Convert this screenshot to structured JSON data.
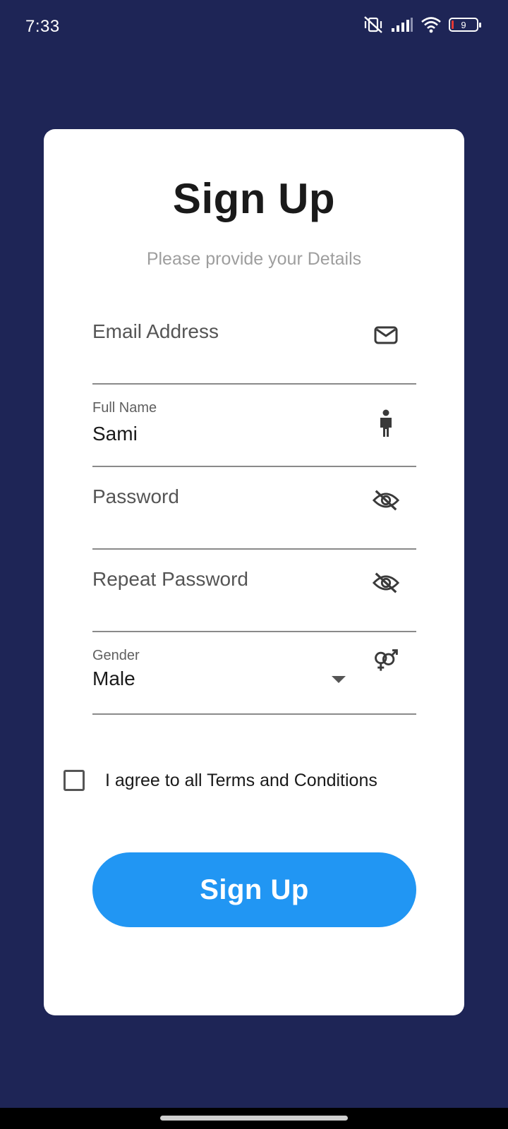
{
  "status_bar": {
    "time": "7:33",
    "battery_level": "9",
    "icons": [
      "vibrate-off-icon",
      "signal-icon",
      "wifi-icon",
      "battery-icon"
    ]
  },
  "colors": {
    "background": "#1e2556",
    "card": "#ffffff",
    "accent": "#2196f3"
  },
  "form": {
    "title": "Sign Up",
    "subtitle": "Please provide your Details",
    "email": {
      "placeholder": "Email Address",
      "value": "",
      "icon": "mail-icon"
    },
    "full_name": {
      "label": "Full Name",
      "value": "Sami",
      "icon": "person-icon"
    },
    "password": {
      "placeholder": "Password",
      "value": "",
      "icon": "visibility-off-icon"
    },
    "repeat_password": {
      "placeholder": "Repeat Password",
      "value": "",
      "icon": "visibility-off-icon"
    },
    "gender": {
      "label": "Gender",
      "selected": "Male",
      "icon": "gender-icon"
    },
    "terms": {
      "label": "I agree to all Terms and Conditions",
      "checked": false
    },
    "submit_label": "Sign Up"
  }
}
